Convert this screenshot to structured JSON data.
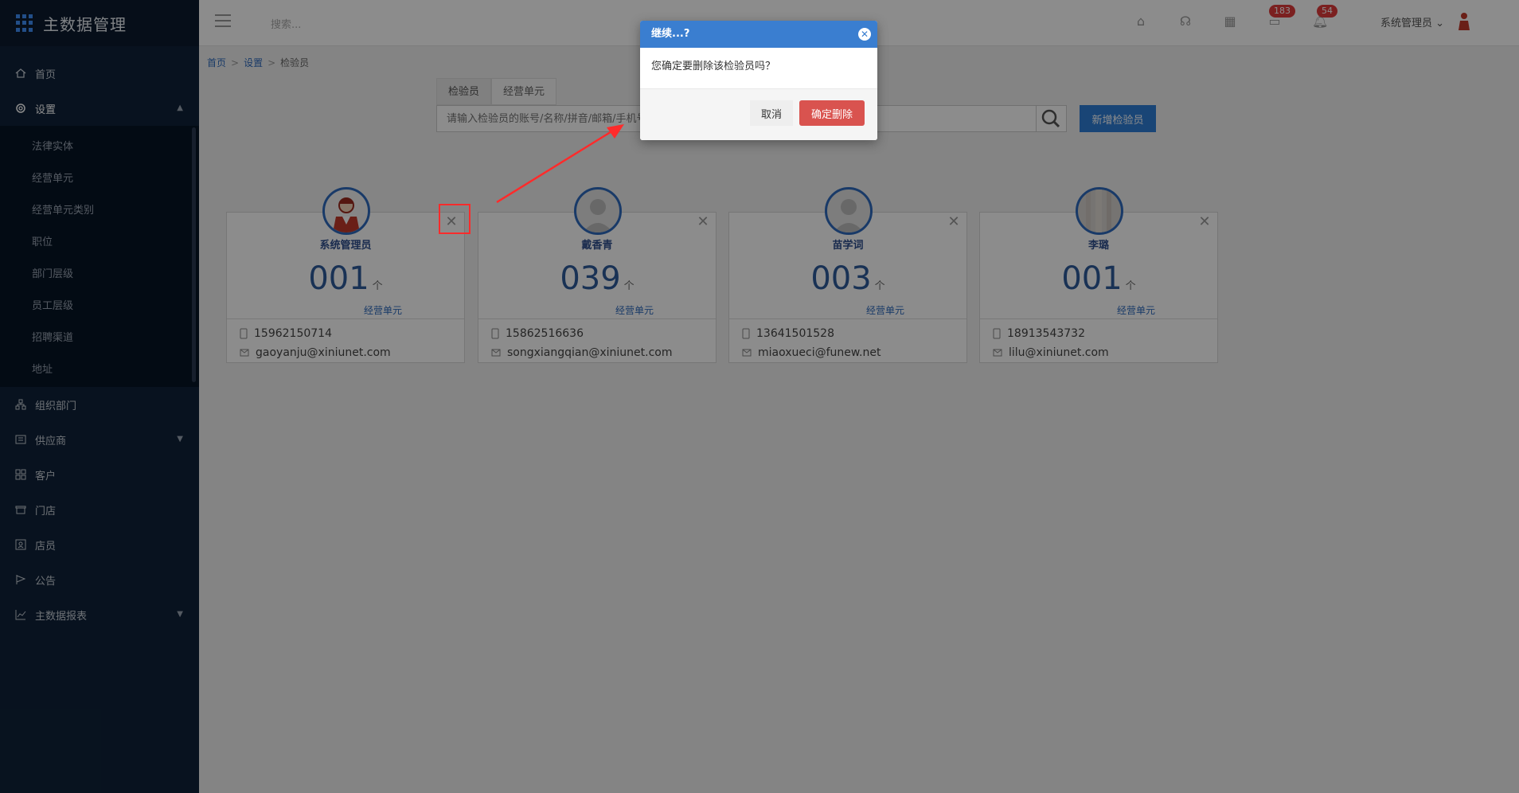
{
  "app": {
    "title": "主数据管理"
  },
  "sidebar": {
    "items": [
      {
        "label": "首页",
        "icon": "home-icon"
      },
      {
        "label": "设置",
        "icon": "gear-icon",
        "expanded": true
      },
      {
        "label": "组织部门",
        "icon": "org-icon"
      },
      {
        "label": "供应商",
        "icon": "supplier-icon"
      },
      {
        "label": "客户",
        "icon": "customer-icon"
      },
      {
        "label": "门店",
        "icon": "store-icon"
      },
      {
        "label": "店员",
        "icon": "clerk-icon"
      },
      {
        "label": "公告",
        "icon": "notice-icon"
      },
      {
        "label": "主数据报表",
        "icon": "chart-icon"
      }
    ],
    "settings_sub": [
      "法律实体",
      "经营单元",
      "经营单元类别",
      "职位",
      "部门层级",
      "员工层级",
      "招聘渠道",
      "地址"
    ]
  },
  "header": {
    "search_placeholder": "搜索...",
    "badge_messages": "183",
    "badge_alerts": "54",
    "user_name": "系统管理员"
  },
  "breadcrumb": {
    "home": "首页",
    "settings": "设置",
    "current": "检验员",
    "sep": ">"
  },
  "tabs": [
    "检验员",
    "经营单元"
  ],
  "search": {
    "placeholder": "请输入检验员的账号/名称/拼音/邮箱/手机号"
  },
  "add_button": "新增检验员",
  "cards": [
    {
      "name": "系统管理员",
      "count": "001",
      "unit": "个",
      "unit_label": "经营单元",
      "phone": "15962150714",
      "email": "gaoyanju@xiniunet.com"
    },
    {
      "name": "戴香青",
      "count": "039",
      "unit": "个",
      "unit_label": "经营单元",
      "phone": "15862516636",
      "email": "songxiangqian@xiniunet.com"
    },
    {
      "name": "苗学词",
      "count": "003",
      "unit": "个",
      "unit_label": "经营单元",
      "phone": "13641501528",
      "email": "miaoxueci@funew.net"
    },
    {
      "name": "李璐",
      "count": "001",
      "unit": "个",
      "unit_label": "经营单元",
      "phone": "18913543732",
      "email": "lilu@xiniunet.com"
    }
  ],
  "dialog": {
    "title": "继续...?",
    "message": "您确定要删除该检验员吗？",
    "cancel": "取消",
    "confirm": "确定删除"
  },
  "colors": {
    "sidebar": "#0f2239",
    "accent": "#2f7fd8",
    "danger": "#d9534f",
    "dialog_header": "#3a7ed0"
  }
}
